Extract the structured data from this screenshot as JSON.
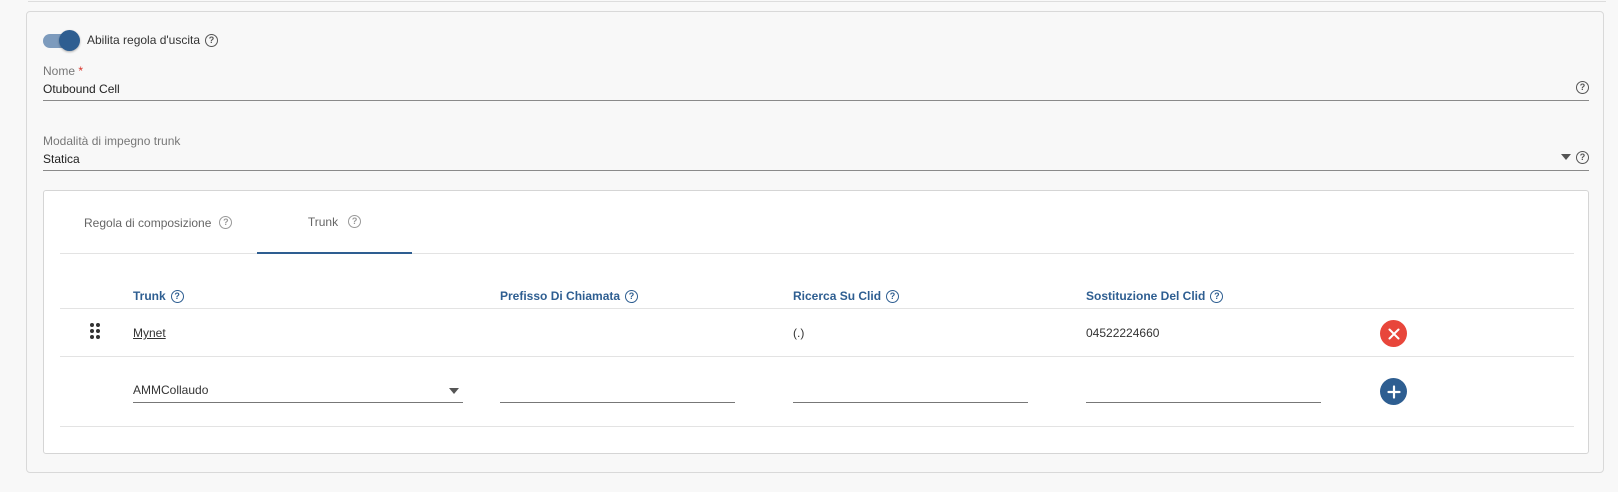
{
  "enable_rule": {
    "label": "Abilita regola d'uscita",
    "enabled": true
  },
  "name_field": {
    "label": "Nome",
    "required_mark": "*",
    "value": "Otubound Cell"
  },
  "mode_field": {
    "label": "Modalità di impegno trunk",
    "value": "Statica"
  },
  "tabs": [
    {
      "label": "Regola di composizione",
      "active": false
    },
    {
      "label": "Trunk",
      "active": true
    }
  ],
  "table": {
    "headers": [
      "Trunk",
      "Prefisso Di Chiamata",
      "Ricerca Su Clid",
      "Sostituzione Del Clid"
    ],
    "rows": [
      {
        "trunk": "Mynet",
        "prefix": "",
        "clid_search": "(.)",
        "clid_replace": "04522224660"
      }
    ],
    "new_row": {
      "trunk_select": "AMMCollaudo",
      "prefix": "",
      "clid_search": "",
      "clid_replace": ""
    }
  },
  "icons": {
    "help": "?",
    "close": "✕",
    "add": "+"
  },
  "colors": {
    "primary": "#2e5e91",
    "danger": "#e8463b"
  }
}
